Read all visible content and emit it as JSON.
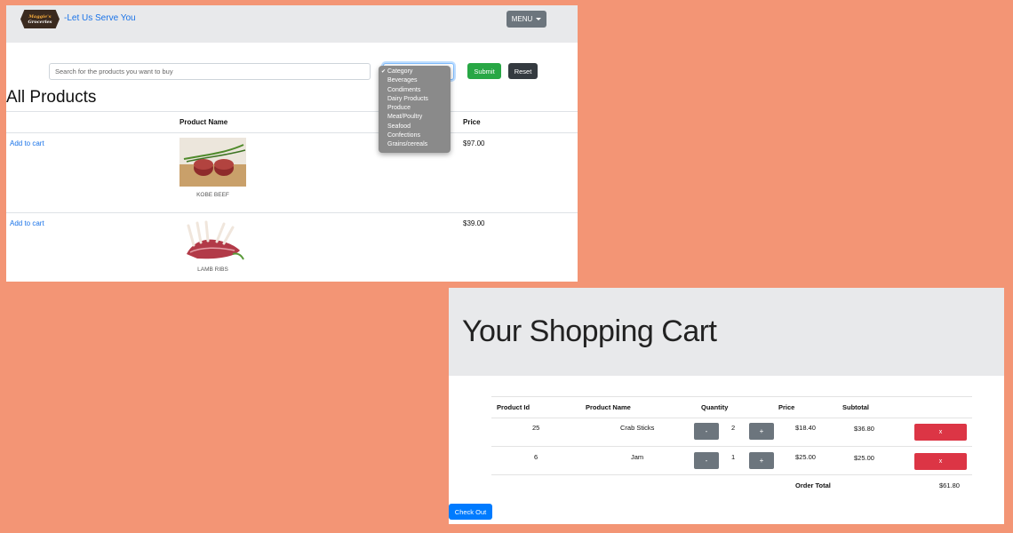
{
  "navbar": {
    "logo": {
      "line1": "Maggie's",
      "line2": "Groceries"
    },
    "tagline": "-Let Us Serve You",
    "menu_label": "MENU"
  },
  "search": {
    "placeholder": "Search for the products you want to buy",
    "submit_label": "Submit",
    "reset_label": "Reset",
    "category_options": [
      "Category",
      "Beverages",
      "Condiments",
      "Dairy Products",
      "Produce",
      "Meat/Poultry",
      "Seafood",
      "Confections",
      "Grains/cereals"
    ],
    "selected_option": "Category"
  },
  "products": {
    "title": "All Products",
    "columns": [
      "Product Name",
      "Price"
    ],
    "items": [
      {
        "action": "Add to cart",
        "name": "KOBE BEEF",
        "price": "$97.00"
      },
      {
        "action": "Add to cart",
        "name": "LAMB RIBS",
        "price": "$39.00"
      }
    ]
  },
  "cart": {
    "title": "Your Shopping Cart",
    "columns": [
      "Product Id",
      "Product Name",
      "Quantity",
      "Price",
      "Subtotal"
    ],
    "rows": [
      {
        "id": "25",
        "name": "Crab Sticks",
        "minus": "-",
        "qty": "2",
        "plus": "+",
        "price": "$18.40",
        "subtotal": "$36.80",
        "remove": "x"
      },
      {
        "id": "6",
        "name": "Jam",
        "minus": "-",
        "qty": "1",
        "plus": "+",
        "price": "$25.00",
        "subtotal": "$25.00",
        "remove": "x"
      }
    ],
    "total_label": "Order Total",
    "total_value": "$61.80",
    "checkout_label": "Check Out"
  },
  "colors": {
    "background": "#f39575",
    "link": "#1a73e8",
    "submit": "#28a745",
    "reset": "#343a40",
    "remove": "#dc3545",
    "checkout": "#007bff"
  }
}
